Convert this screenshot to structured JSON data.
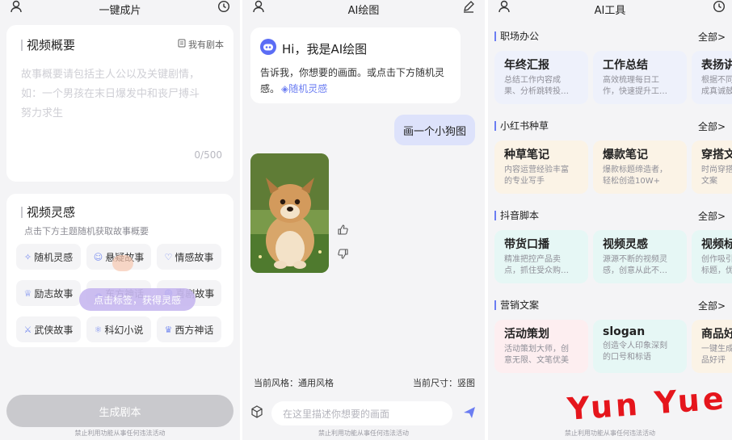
{
  "screen1": {
    "title": "一键成片",
    "overview": {
      "heading": "视频概要",
      "script_link": "我有剧本",
      "placeholder": "故事概要请包括主人公以及关键剧情，如：一个男孩在末日爆发中和丧尸搏斗努力求生",
      "counter": "0/500"
    },
    "inspiration": {
      "heading": "视频灵感",
      "hint": "点击下方主题随机获取故事概要",
      "chips": [
        {
          "label": "随机灵感",
          "icon": "sparkle-icon"
        },
        {
          "label": "悬疑故事",
          "icon": "mask-icon"
        },
        {
          "label": "情感故事",
          "icon": "heart-icon"
        },
        {
          "label": "励志故事",
          "icon": "trophy-icon"
        },
        {
          "label": "东方神话",
          "icon": "cloud-icon"
        },
        {
          "label": "喜剧故事",
          "icon": "smile-icon"
        },
        {
          "label": "武侠故事",
          "icon": "sword-icon"
        },
        {
          "label": "科幻小说",
          "icon": "atom-icon"
        },
        {
          "label": "西方神话",
          "icon": "crown-icon"
        }
      ],
      "tooltip": "点击标签，获得灵感"
    },
    "generate_button": "生成剧本",
    "footer": "禁止利用功能从事任何违法活动"
  },
  "screen2": {
    "title": "AI绘图",
    "greeting": "Hi，我是AI绘图",
    "intro": "告诉我，你想要的画面。或点击下方随机灵感。",
    "random_link": "随机灵感",
    "user_message": "画一个小狗图",
    "result_image": "puppy-image",
    "style_label": "当前风格：通用风格",
    "size_label": "当前尺寸：竖图",
    "input_placeholder": "在这里描述你想要的画面",
    "footer": "禁止利用功能从事任何违法活动"
  },
  "screen3": {
    "title": "AI工具",
    "all_label": "全部>",
    "sections": [
      {
        "name": "职场办公",
        "tools": [
          {
            "title": "年终汇报",
            "desc": "总结工作内容成\n果、分析跳转投…",
            "color": "#eef1fb"
          },
          {
            "title": "工作总结",
            "desc": "高效梳理每日工\n作，快速提升工…",
            "color": "#eef1fb"
          },
          {
            "title": "表扬讲",
            "desc": "根据不同\n成真诚鼓",
            "color": "#eef1fb"
          }
        ]
      },
      {
        "name": "小红书种草",
        "tools": [
          {
            "title": "种草笔记",
            "desc": "内容运营经验丰富\n的专业写手",
            "color": "#fbf3e6"
          },
          {
            "title": "爆款笔记",
            "desc": "爆款标题缔造者，\n轻松创造10W+",
            "color": "#fbf3e6"
          },
          {
            "title": "穿搭文",
            "desc": "时尚穿搭\n文案",
            "color": "#fbf3e6"
          }
        ]
      },
      {
        "name": "抖音脚本",
        "tools": [
          {
            "title": "带货口播",
            "desc": "精准把控产品卖\n点，抓住受众购…",
            "color": "#e6f7f5"
          },
          {
            "title": "视频灵感",
            "desc": "源源不断的视频灵\n感，创意从此不…",
            "color": "#e6f7f5"
          },
          {
            "title": "视频标",
            "desc": "创作吸引\n标题，优",
            "color": "#e6f7f5"
          }
        ]
      },
      {
        "name": "营销文案",
        "tools": [
          {
            "title": "活动策划",
            "desc": "活动策划大师，创\n意无限、文笔优美",
            "color": "#fdeef0"
          },
          {
            "title": "slogan",
            "desc": "创造令人印象深刻\n的口号和标语",
            "color": "#e6f7f5"
          },
          {
            "title": "商品好",
            "desc": "一键生成\n品好评",
            "color": "#fbf3e6"
          }
        ]
      }
    ],
    "watermark": "Yun Yue",
    "footer": "禁止利用功能从事任何违法活动"
  }
}
